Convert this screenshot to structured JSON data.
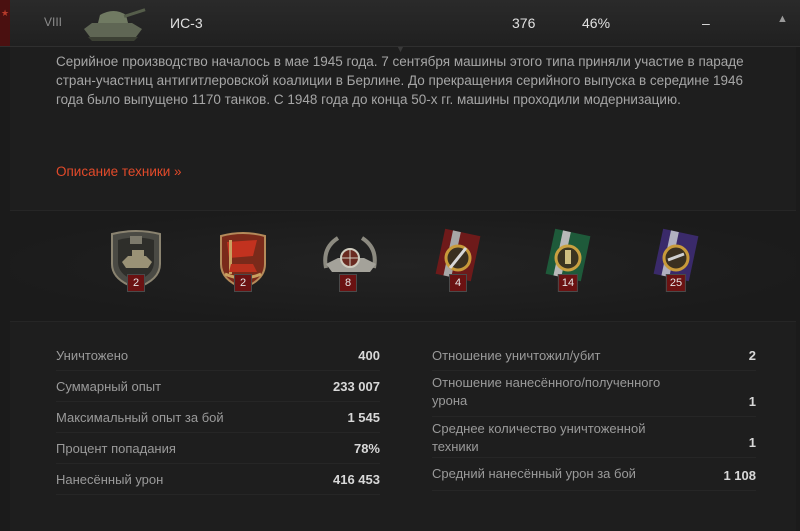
{
  "header": {
    "tier": "VIII",
    "tank_name": "ИС-3",
    "battles": "376",
    "win_rate": "46%",
    "mastery": "–"
  },
  "description": {
    "text": "Серийное производство началось в мае 1945 года. 7 сентября машины этого типа приняли участие в параде стран-участниц антигитлеровской коалиции в Берлине. До прекращения серийного выпуска в середине 1946 года было выпущено 1170 танков. С 1948 года до конца 50-х гг. машины проходили модернизацию.",
    "link": "Описание техники »"
  },
  "medals": [
    {
      "icon": "mastery-badge-icon",
      "count": "2"
    },
    {
      "icon": "red-banner-badge-icon",
      "count": "2"
    },
    {
      "icon": "sniper-wreath-icon",
      "count": "8"
    },
    {
      "icon": "red-ribbon-medal-icon",
      "count": "4"
    },
    {
      "icon": "green-ribbon-medal-icon",
      "count": "14"
    },
    {
      "icon": "purple-ribbon-medal-icon",
      "count": "25"
    }
  ],
  "stats_left": [
    {
      "label": "Уничтожено",
      "value": "400"
    },
    {
      "label": "Суммарный опыт",
      "value": "233 007"
    },
    {
      "label": "Максимальный опыт за бой",
      "value": "1 545"
    },
    {
      "label": "Процент попадания",
      "value": "78%"
    },
    {
      "label": "Нанесённый урон",
      "value": "416 453"
    }
  ],
  "stats_right": [
    {
      "label": "Отношение уничтожил/убит",
      "value": "2"
    },
    {
      "label": "Отношение нанесённого/полученного урона",
      "value": "1"
    },
    {
      "label": "Среднее количество уничтоженной техники",
      "value": "1"
    },
    {
      "label": "Средний нанесённый урон за бой",
      "value": "1 108"
    }
  ],
  "colors": {
    "accent_link": "#e24a2a",
    "badge": "#6b1212",
    "background": "#1e1e1e"
  }
}
